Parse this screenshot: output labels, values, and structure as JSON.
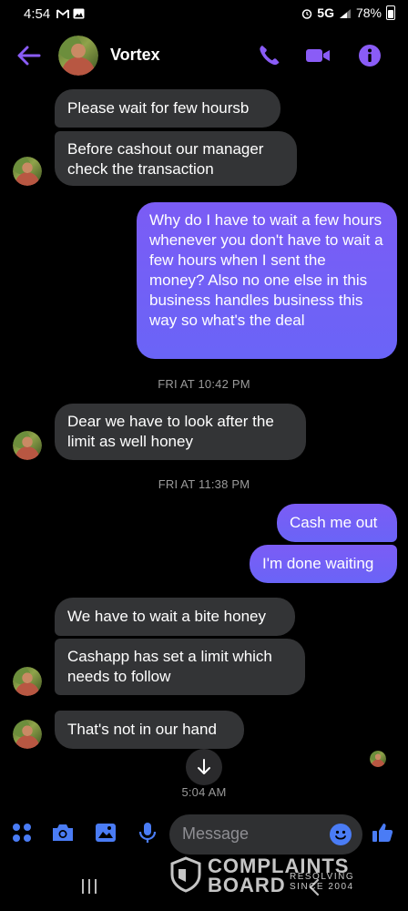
{
  "status_bar": {
    "time": "4:54",
    "network": "5G",
    "battery": "78%",
    "battery_level": 0.78,
    "icons": [
      "gmail-icon",
      "gallery-icon",
      "alarm-icon",
      "signal-icon",
      "battery-icon"
    ]
  },
  "header": {
    "contact_name": "Vortex",
    "icons": [
      "back-arrow-icon",
      "phone-icon",
      "video-camera-icon",
      "info-icon"
    ]
  },
  "messages": {
    "m1": "Please wait for few hoursb",
    "m2": "Before cashout our manager check the transaction",
    "m3": "Why do I have to wait a few hours whenever you don't have to wait a few hours when I sent the money? Also no one else in this business handles business this way so what's the deal",
    "ts1": "FRI AT 10:42 PM",
    "m4": "Dear we have to look after the limit as well honey",
    "ts2": "FRI AT 11:38 PM",
    "m5": "Cash me out",
    "m6": "I'm done waiting",
    "m7": "We have to wait a bite honey",
    "m8": "Cashapp has set a limit which needs to follow",
    "m9": "That's not in our hand",
    "ts3": "5:04 AM"
  },
  "composer": {
    "placeholder": "Message",
    "icons": [
      "apps-icon",
      "camera-icon",
      "image-icon",
      "microphone-icon",
      "emoji-icon",
      "thumbs-up-icon"
    ]
  },
  "watermark": {
    "line1": "COMPLAINTS",
    "line2": "BOARD",
    "tagline": "RESOLVING SINCE 2004"
  },
  "colors": {
    "accent": "#8a5cf6",
    "incoming_bubble": "#333436",
    "outgoing_gradient_top": "#7b5cf5",
    "outgoing_gradient_bottom": "#6a64f7",
    "background": "#000000",
    "blue_icons": "#4a7cf5"
  }
}
